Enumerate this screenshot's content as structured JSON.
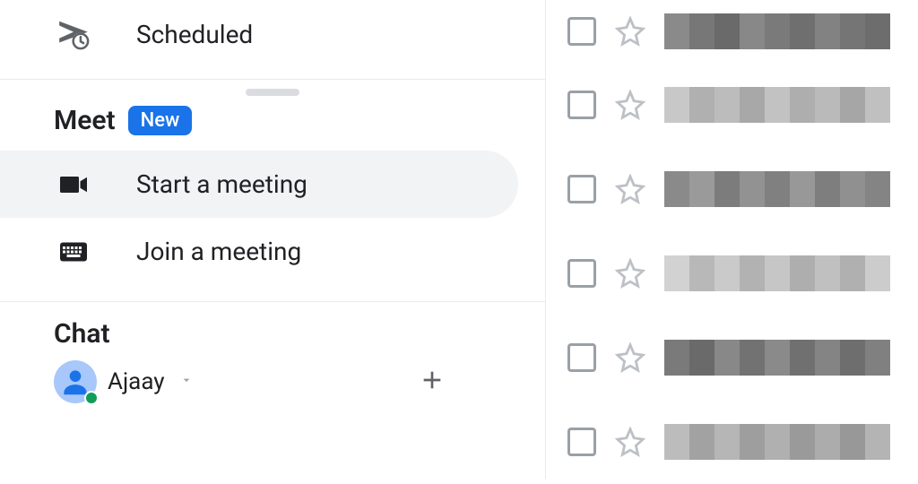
{
  "sidebar": {
    "scheduled_label": "Scheduled",
    "meet": {
      "title": "Meet",
      "badge": "New",
      "start_label": "Start a meeting",
      "join_label": "Join a meeting"
    },
    "chat": {
      "title": "Chat",
      "user_name": "Ajaay"
    }
  },
  "mail_rows": 6
}
